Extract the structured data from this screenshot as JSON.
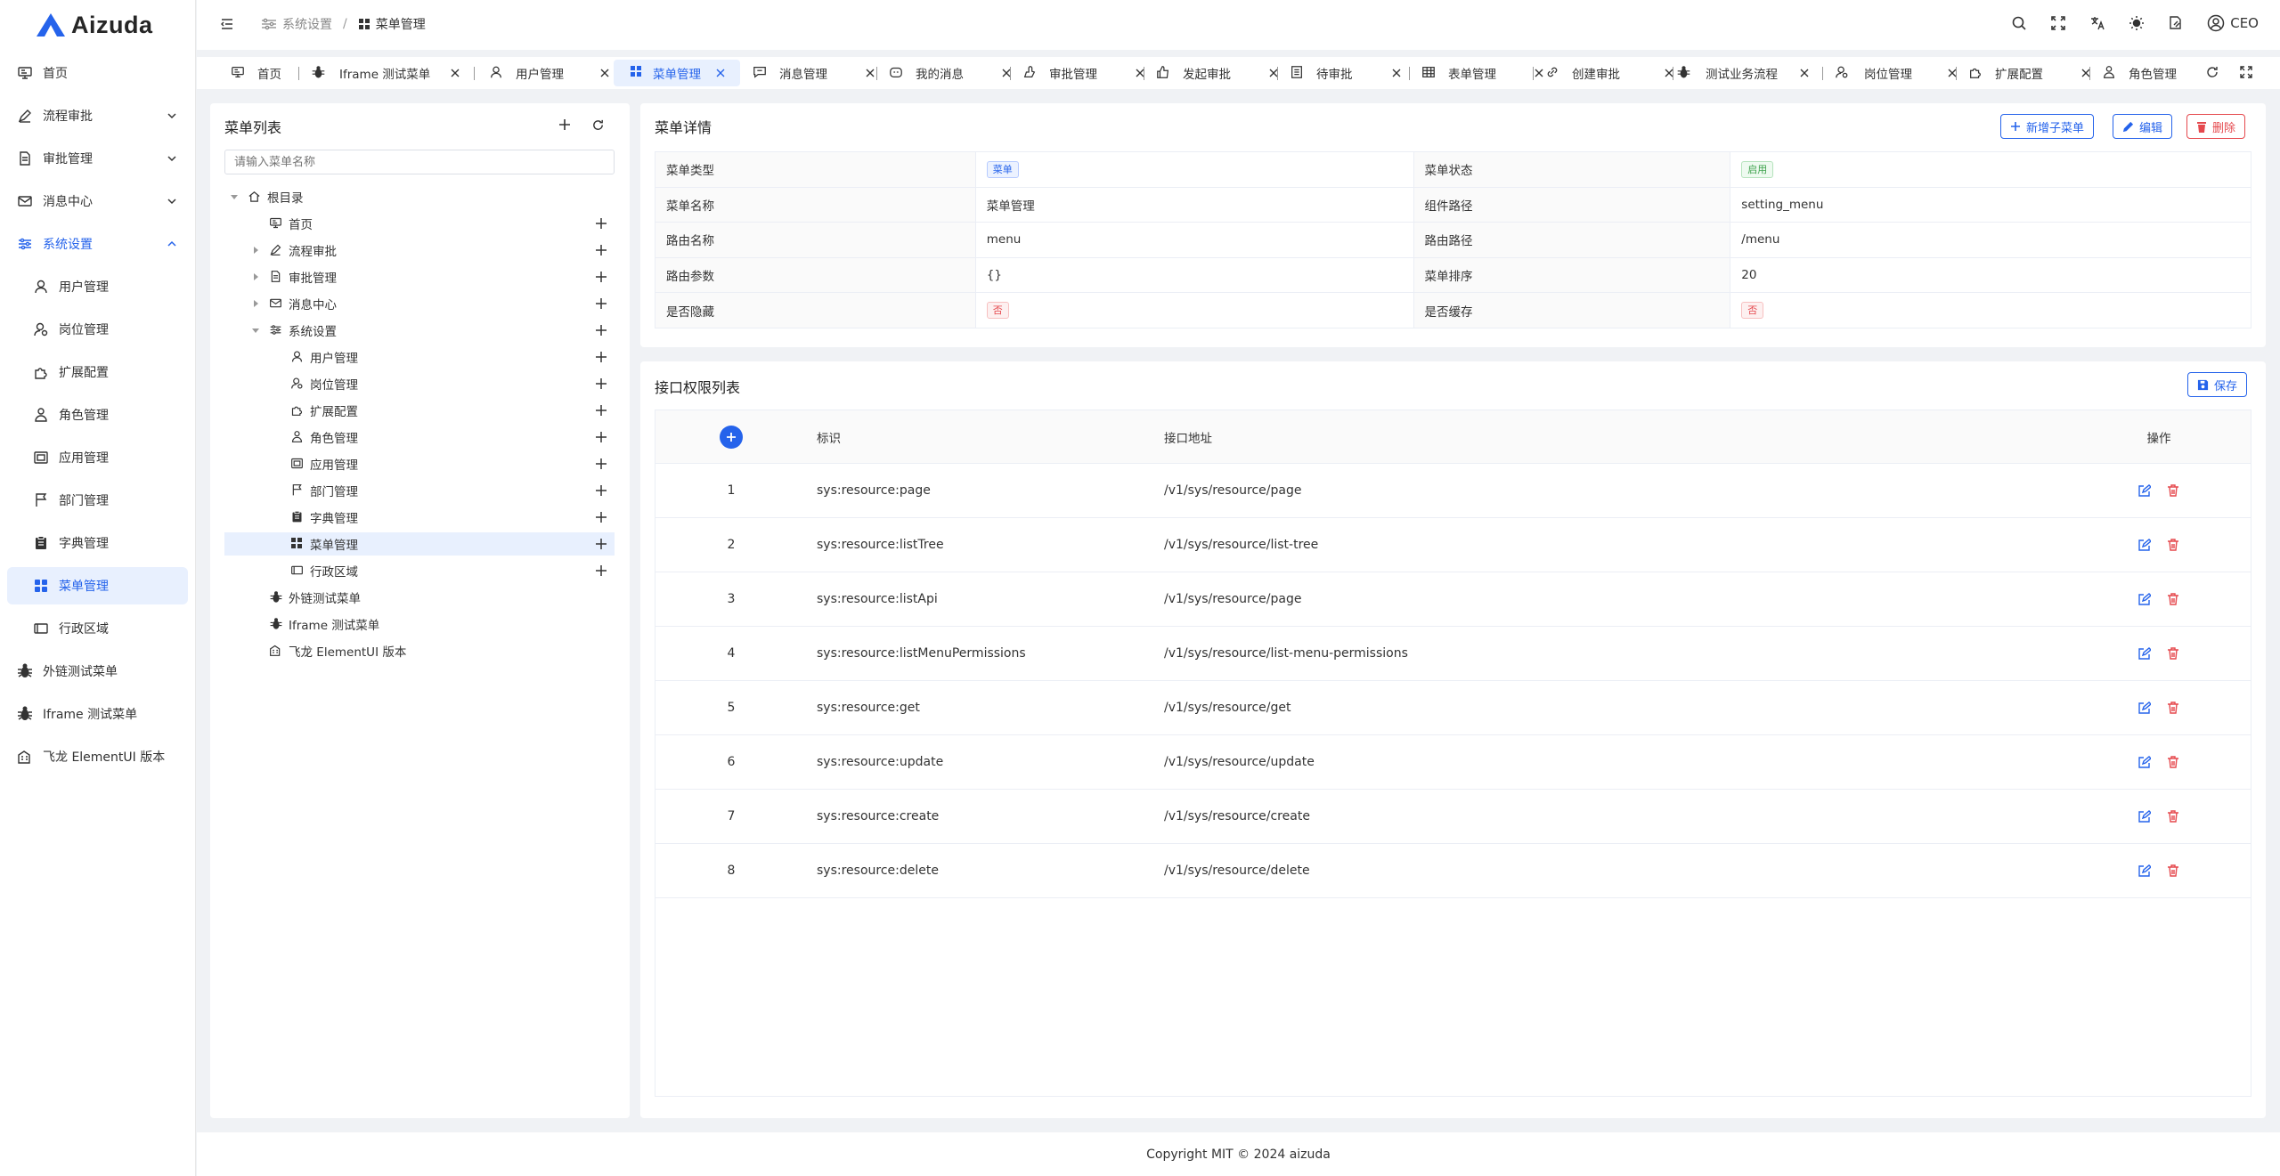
{
  "app": {
    "logo_text": "Aizuda"
  },
  "sidebar": {
    "items": [
      {
        "label": "首页",
        "icon": "monitor-icon",
        "expandable": false
      },
      {
        "label": "流程审批",
        "icon": "pen-icon",
        "expandable": true
      },
      {
        "label": "审批管理",
        "icon": "document-icon",
        "expandable": true
      },
      {
        "label": "消息中心",
        "icon": "mail-icon",
        "expandable": true
      },
      {
        "label": "系统设置",
        "icon": "sliders-icon",
        "expandable": true,
        "expanded": true
      },
      {
        "label": "用户管理",
        "icon": "user-icon"
      },
      {
        "label": "岗位管理",
        "icon": "user-badge-icon"
      },
      {
        "label": "扩展配置",
        "icon": "puzzle-icon"
      },
      {
        "label": "角色管理",
        "icon": "users-icon"
      },
      {
        "label": "应用管理",
        "icon": "app-icon"
      },
      {
        "label": "部门管理",
        "icon": "flag-icon"
      },
      {
        "label": "字典管理",
        "icon": "clipboard-icon"
      },
      {
        "label": "菜单管理",
        "icon": "grid-icon",
        "active": true
      },
      {
        "label": "行政区域",
        "icon": "card-icon"
      },
      {
        "label": "外链测试菜单",
        "icon": "bug-icon"
      },
      {
        "label": "Iframe 测试菜单",
        "icon": "bug-icon"
      },
      {
        "label": "飞龙 ElementUI 版本",
        "icon": "building-icon"
      }
    ]
  },
  "header": {
    "breadcrumb": [
      "系统设置",
      "菜单管理"
    ],
    "user": "CEO"
  },
  "tabs": [
    {
      "label": "首页",
      "closable": false
    },
    {
      "label": "Iframe 测试菜单",
      "closable": true
    },
    {
      "label": "用户管理",
      "closable": true
    },
    {
      "label": "菜单管理",
      "closable": true,
      "active": true
    },
    {
      "label": "消息管理",
      "closable": true
    },
    {
      "label": "我的消息",
      "closable": true
    },
    {
      "label": "审批管理",
      "closable": true
    },
    {
      "label": "发起审批",
      "closable": true
    },
    {
      "label": "待审批",
      "closable": true
    },
    {
      "label": "表单管理",
      "closable": true
    },
    {
      "label": "创建审批",
      "closable": true
    },
    {
      "label": "测试业务流程",
      "closable": true
    },
    {
      "label": "岗位管理",
      "closable": true
    },
    {
      "label": "扩展配置",
      "closable": true
    },
    {
      "label": "角色管理",
      "closable": false
    }
  ],
  "tree": {
    "title": "菜单列表",
    "search_placeholder": "请输入菜单名称",
    "nodes": [
      {
        "label": "根目录"
      },
      {
        "label": "首页"
      },
      {
        "label": "流程审批"
      },
      {
        "label": "审批管理"
      },
      {
        "label": "消息中心"
      },
      {
        "label": "系统设置"
      },
      {
        "label": "用户管理"
      },
      {
        "label": "岗位管理"
      },
      {
        "label": "扩展配置"
      },
      {
        "label": "角色管理"
      },
      {
        "label": "应用管理"
      },
      {
        "label": "部门管理"
      },
      {
        "label": "字典管理"
      },
      {
        "label": "菜单管理",
        "selected": true
      },
      {
        "label": "行政区域"
      },
      {
        "label": "外链测试菜单"
      },
      {
        "label": "Iframe 测试菜单"
      },
      {
        "label": "飞龙 ElementUI 版本"
      }
    ]
  },
  "detail": {
    "title": "菜单详情",
    "add_child_label": "新增子菜单",
    "edit_label": "编辑",
    "delete_label": "删除",
    "rows": [
      {
        "k1": "菜单类型",
        "v1": "菜单",
        "k2": "菜单状态",
        "v2": "启用"
      },
      {
        "k1": "菜单名称",
        "v1": "菜单管理",
        "k2": "组件路径",
        "v2": "setting_menu"
      },
      {
        "k1": "路由名称",
        "v1": "menu",
        "k2": "路由路径",
        "v2": "/menu"
      },
      {
        "k1": "路由参数",
        "v1": "{}",
        "k2": "菜单排序",
        "v2": "20"
      },
      {
        "k1": "是否隐藏",
        "v1": "否",
        "k2": "是否缓存",
        "v2": "否"
      }
    ]
  },
  "permissions": {
    "title": "接口权限列表",
    "save_label": "保存",
    "columns": {
      "key": "标识",
      "url": "接口地址",
      "op": "操作"
    },
    "rows": [
      {
        "idx": "1",
        "key": "sys:resource:page",
        "url": "/v1/sys/resource/page"
      },
      {
        "idx": "2",
        "key": "sys:resource:listTree",
        "url": "/v1/sys/resource/list-tree"
      },
      {
        "idx": "3",
        "key": "sys:resource:listApi",
        "url": "/v1/sys/resource/page"
      },
      {
        "idx": "4",
        "key": "sys:resource:listMenuPermissions",
        "url": "/v1/sys/resource/list-menu-permissions"
      },
      {
        "idx": "5",
        "key": "sys:resource:get",
        "url": "/v1/sys/resource/get"
      },
      {
        "idx": "6",
        "key": "sys:resource:update",
        "url": "/v1/sys/resource/update"
      },
      {
        "idx": "7",
        "key": "sys:resource:create",
        "url": "/v1/sys/resource/create"
      },
      {
        "idx": "8",
        "key": "sys:resource:delete",
        "url": "/v1/sys/resource/delete"
      }
    ]
  },
  "footer": {
    "text": "Copyright MIT © 2024 aizuda"
  },
  "colors": {
    "accent": "#2563eb",
    "danger": "#e5484d",
    "success": "#3fa34d"
  }
}
